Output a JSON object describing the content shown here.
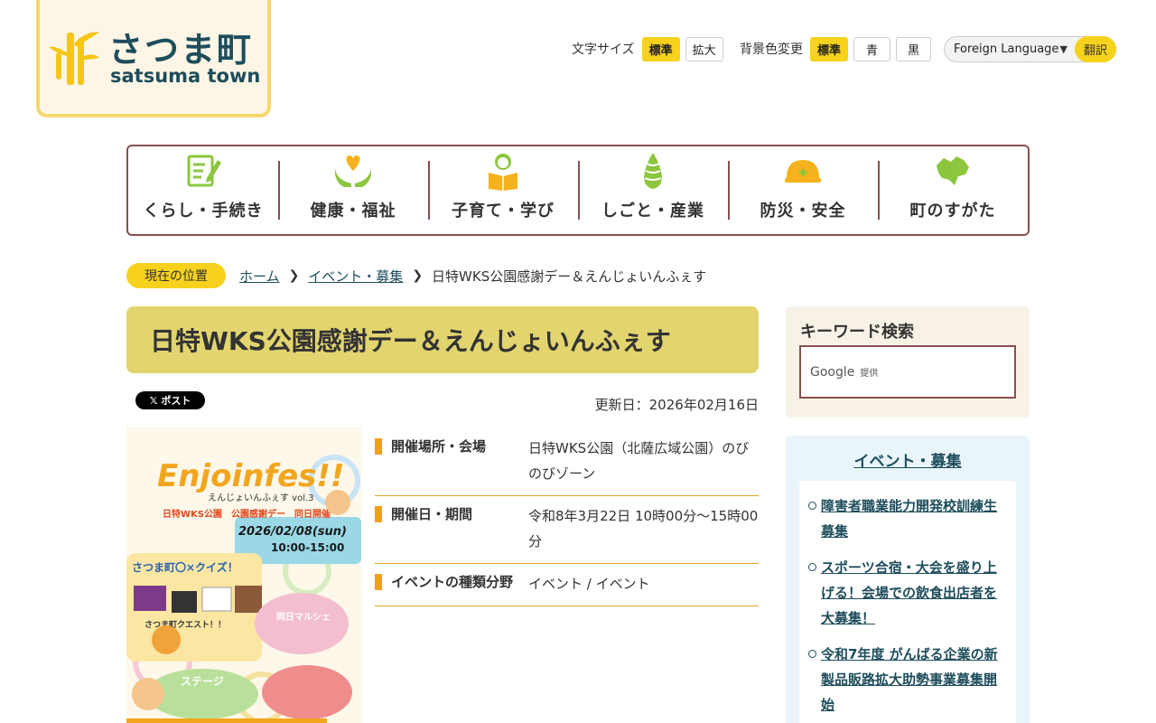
{
  "header": {
    "logo_jp": "さつま町",
    "logo_en": "satsuma town",
    "font_size_label": "文字サイズ",
    "font_size_options": [
      "標準",
      "拡大"
    ],
    "bg_label": "背景色変更",
    "bg_options": [
      "標準",
      "青",
      "黒"
    ],
    "language_select": "Foreign Language",
    "translate_label": "翻訳"
  },
  "nav": {
    "items": [
      {
        "label": "くらし・手続き",
        "icon": "form-pencil-icon"
      },
      {
        "label": "健康・福祉",
        "icon": "heart-hands-icon"
      },
      {
        "label": "子育て・学び",
        "icon": "child-book-icon"
      },
      {
        "label": "しごと・産業",
        "icon": "bamboo-shoot-icon"
      },
      {
        "label": "防災・安全",
        "icon": "helmet-icon"
      },
      {
        "label": "町のすがた",
        "icon": "town-map-icon"
      }
    ]
  },
  "breadcrumb": {
    "badge": "現在の位置",
    "home": "ホーム",
    "category": "イベント・募集",
    "current": "日特WKS公園感謝デー＆えんじょいんふぇす"
  },
  "main": {
    "title": "日特WKS公園感謝デー＆えんじょいんふぇす",
    "post_button": "𝕏 ポスト",
    "updated": "更新日：2026年02月16日",
    "info": [
      {
        "key": "開催場所・会場",
        "value": "日特WKS公園（北薩広域公園）のびのびゾーン"
      },
      {
        "key": "開催日・期間",
        "value": "令和8年3月22日 10時00分～15時00分"
      },
      {
        "key": "イベントの種類分野",
        "value": "イベント / イベント"
      }
    ],
    "poster": {
      "headline": "Enjoinfes!!",
      "sub": "えんじょいんふぇす vol.3",
      "subtitle": "日特WKS公園　公園感謝デー　同日開催",
      "date": "2026/02/08(sun)",
      "time": "10:00-15:00",
      "quiz": "さつま町〇×クイズ！",
      "quest": "さつま町クエスト！！",
      "marche": "同日マルシェ",
      "stage": "ステージ"
    }
  },
  "sidebar": {
    "search_title": "キーワード検索",
    "search_placeholder": "Google",
    "search_provided": "提供",
    "events_title": "イベント・募集",
    "events": [
      "障害者職業能力開発校訓練生募集",
      "スポーツ合宿・大会を盛り上げる！会場での飲食出店者を大募集！",
      "令和7年度 がんばる企業の新製品販路拡大助勢事業募集開始"
    ]
  }
}
